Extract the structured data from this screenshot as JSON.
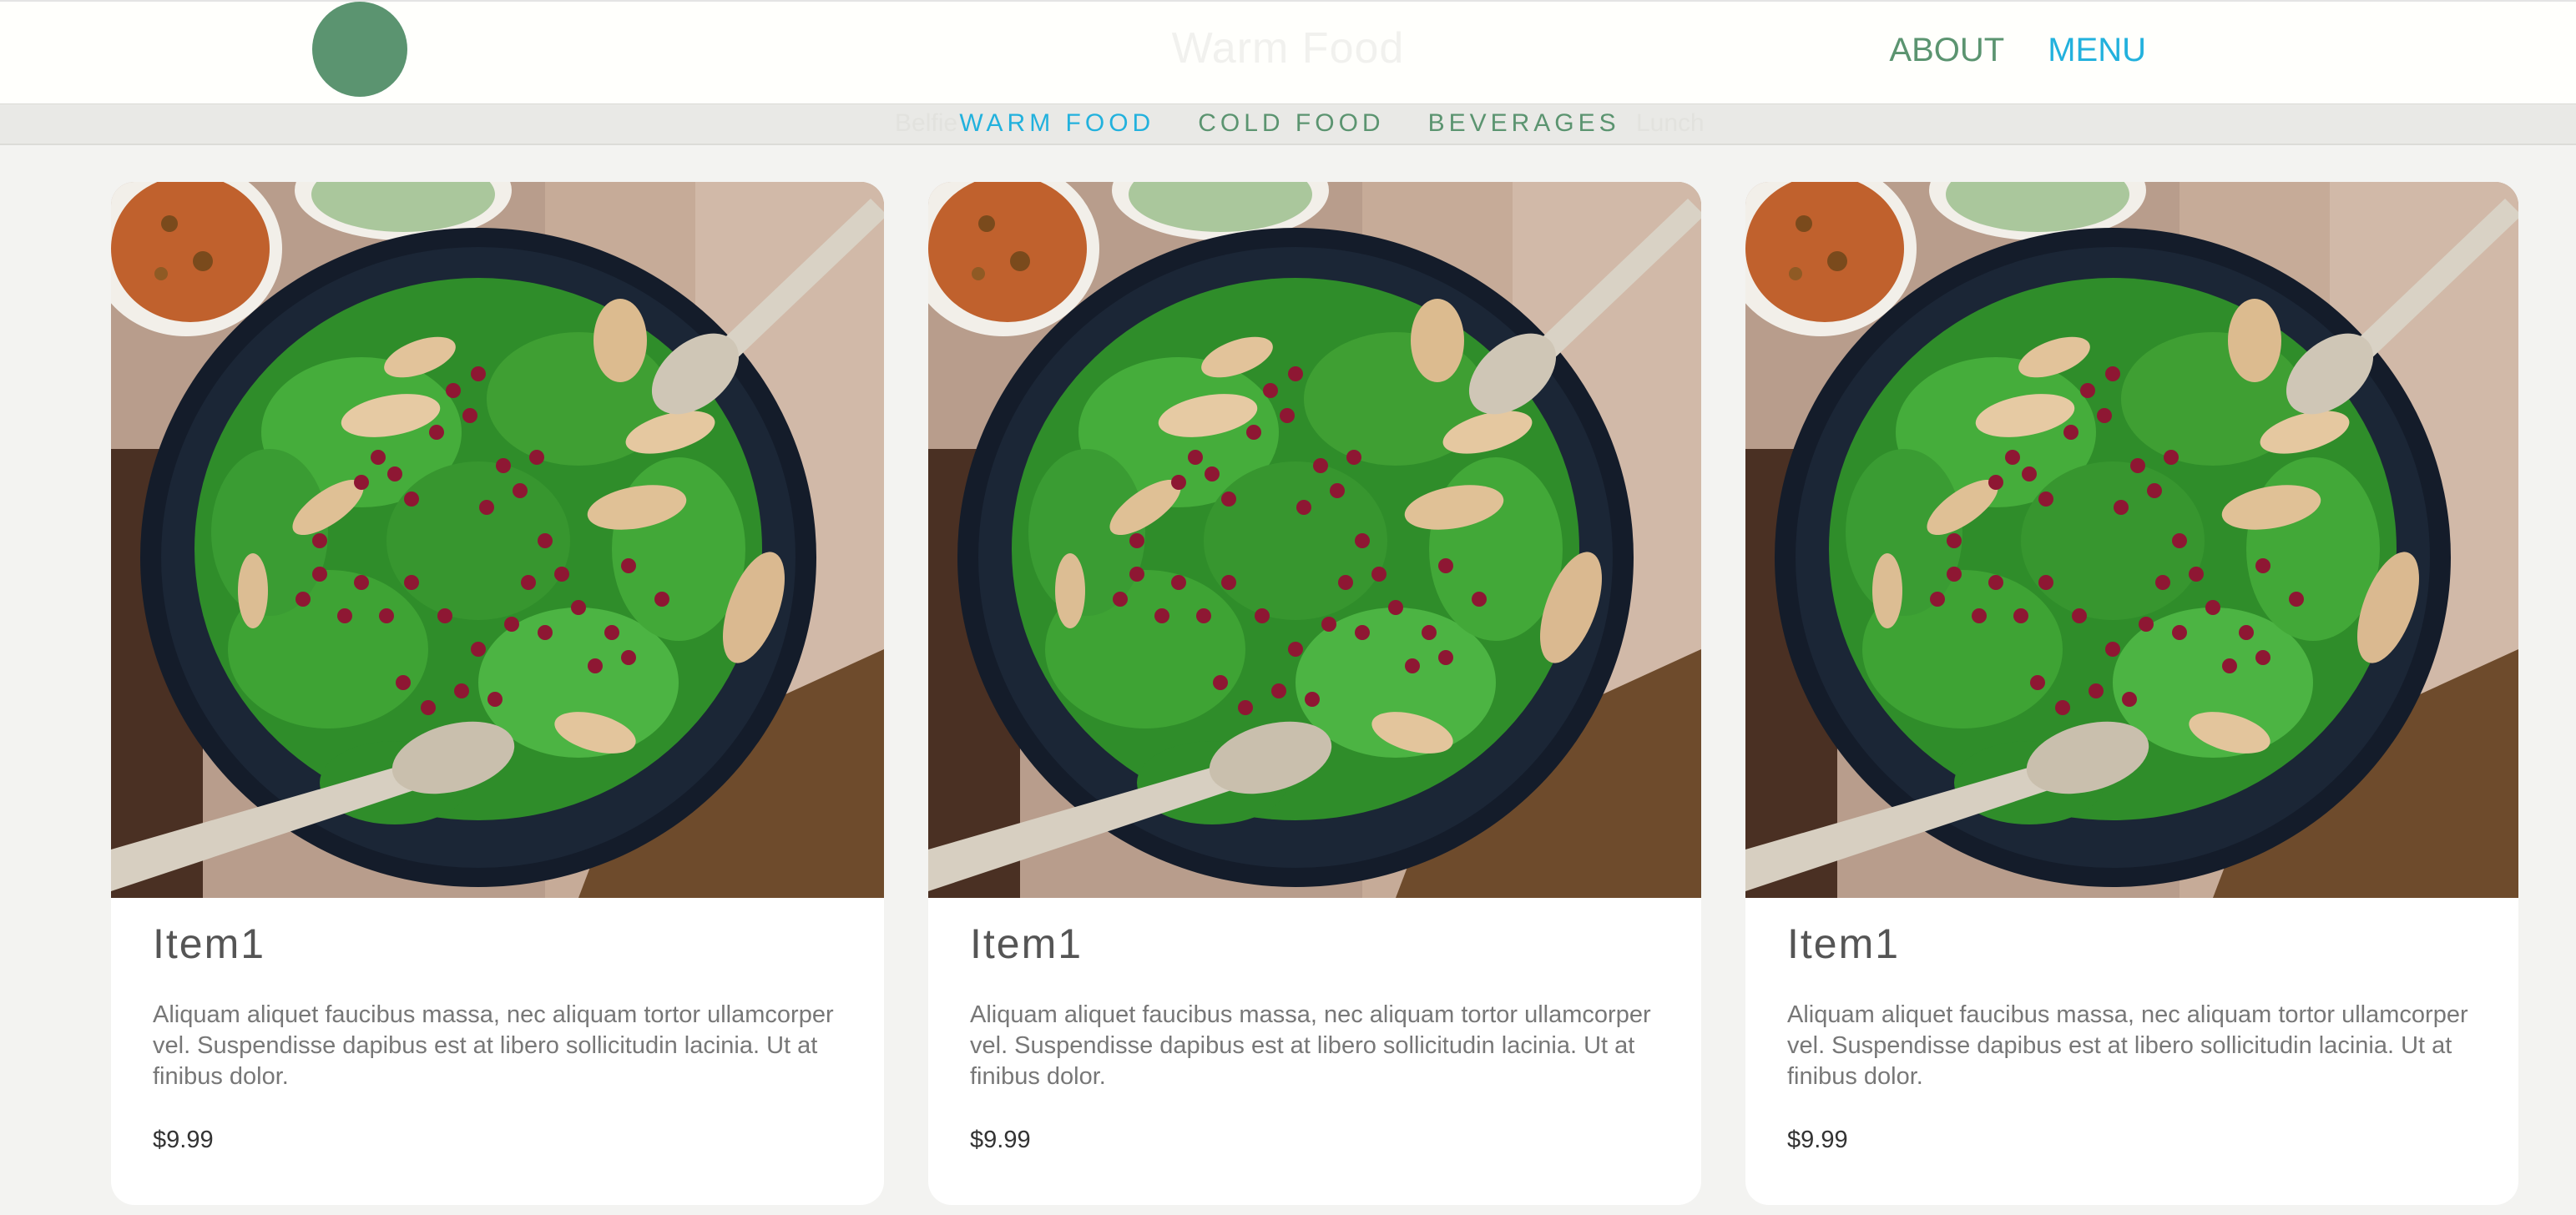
{
  "header": {
    "title": "Warm Food",
    "nav": [
      {
        "label": "ABOUT"
      },
      {
        "label": "MENU"
      }
    ]
  },
  "category_bar": {
    "ghost_left": "Belfie",
    "ghost_right": "Lunch",
    "categories": [
      {
        "label": "WARM FOOD"
      },
      {
        "label": "COLD FOOD"
      },
      {
        "label": "BEVERAGES"
      }
    ]
  },
  "items": [
    {
      "title": "Item1",
      "description": "Aliquam aliquet faucibus massa, nec aliquam tortor ullamcorper vel. Suspendisse dapibus est at libero sollicitudin lacinia. Ut at finibus dolor.",
      "price": "$9.99"
    },
    {
      "title": "Item1",
      "description": "Aliquam aliquet faucibus massa, nec aliquam tortor ullamcorper vel. Suspendisse dapibus est at libero sollicitudin lacinia. Ut at finibus dolor.",
      "price": "$9.99"
    },
    {
      "title": "Item1",
      "description": "Aliquam aliquet faucibus massa, nec aliquam tortor ullamcorper vel. Suspendisse dapibus est at libero sollicitudin lacinia. Ut at finibus dolor.",
      "price": "$9.99"
    }
  ],
  "colors": {
    "accent_blue": "#22b1dd",
    "brand_green": "#5b9470"
  }
}
